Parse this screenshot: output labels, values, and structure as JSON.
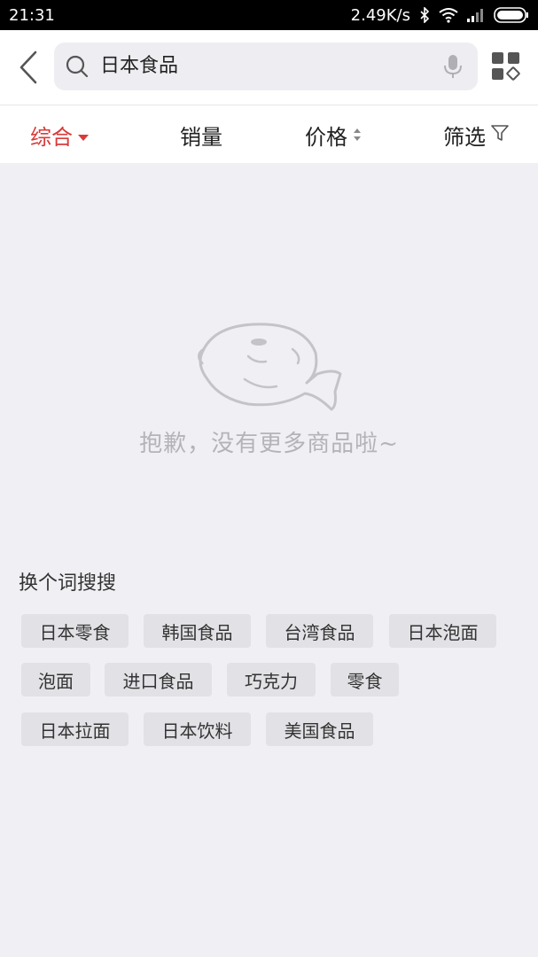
{
  "status_bar": {
    "time": "21:31",
    "network_speed": "2.49K/s",
    "icons": [
      "bluetooth-icon",
      "wifi-icon",
      "signal-icon",
      "battery-icon"
    ]
  },
  "search": {
    "query": "日本食品",
    "icons": [
      "back-arrow-icon",
      "search-icon",
      "microphone-icon",
      "grid-menu-icon"
    ]
  },
  "tabs": [
    {
      "label": "综合",
      "active": true,
      "indicator": "triangle-down-icon"
    },
    {
      "label": "销量",
      "active": false
    },
    {
      "label": "价格",
      "active": false,
      "indicator": "sort-arrows-icon"
    },
    {
      "label": "筛选",
      "active": false,
      "indicator": "filter-funnel-icon"
    }
  ],
  "empty_state": {
    "message": "抱歉，没有更多商品啦~",
    "illustration": "fish-outline-icon"
  },
  "suggestions": {
    "title": "换个词搜搜",
    "chips": [
      "日本零食",
      "韩国食品",
      "台湾食品",
      "日本泡面",
      "泡面",
      "进口食品",
      "巧克力",
      "零食",
      "日本拉面",
      "日本饮料",
      "美国食品"
    ]
  },
  "colors": {
    "accent": "#d93a3a",
    "background": "#f0f0f4",
    "chip_bg": "#e2e2e6"
  }
}
